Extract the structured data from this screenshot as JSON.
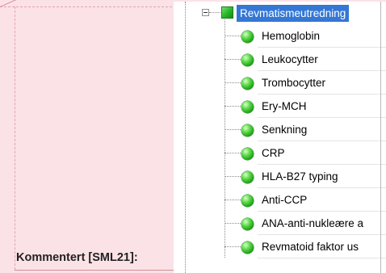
{
  "comment": {
    "label": "Kommentert [SML21]:"
  },
  "tree": {
    "root": {
      "label": "Revmatismeutredning",
      "expander": "minus",
      "icon": "green-square-icon",
      "selected": true
    },
    "children": [
      {
        "label": "Hemoglobin",
        "icon": "green-ball-icon"
      },
      {
        "label": "Leukocytter",
        "icon": "green-ball-icon"
      },
      {
        "label": "Trombocytter",
        "icon": "green-ball-icon"
      },
      {
        "label": "Ery-MCH",
        "icon": "green-ball-icon"
      },
      {
        "label": "Senkning",
        "icon": "green-ball-icon"
      },
      {
        "label": "CRP",
        "icon": "green-ball-icon"
      },
      {
        "label": "HLA-B27 typing",
        "icon": "green-ball-icon"
      },
      {
        "label": "Anti-CCP",
        "icon": "green-ball-icon"
      },
      {
        "label": "ANA-anti-nukleære a",
        "icon": "green-ball-icon"
      },
      {
        "label": "Revmatoid faktor us",
        "icon": "green-ball-icon"
      }
    ]
  },
  "colors": {
    "comment_background": "#fbe2e6",
    "selection": "#3477d5",
    "status_green": "#22a31a"
  }
}
